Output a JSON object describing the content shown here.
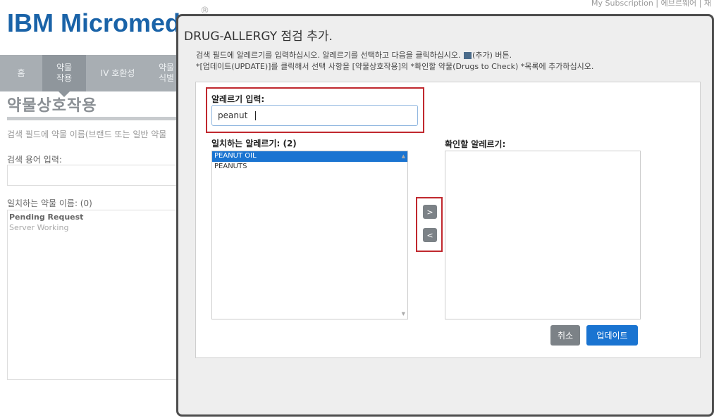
{
  "app": {
    "logo": "IBM Micromede",
    "reg_mark": "®",
    "top_links": "My Subscription | 에브르웨어 | 재"
  },
  "nav": {
    "items": [
      {
        "label": "홈",
        "sub": ""
      },
      {
        "label": "약물",
        "sub": "작용"
      },
      {
        "label": "IV 호환성",
        "sub": ""
      },
      {
        "label": "약물",
        "sub": "식별"
      }
    ]
  },
  "page": {
    "title": "약물상호작용",
    "search_hint": "검색 필드에 약물 이름(브랜드 또는 일반 약물",
    "search_label": "검색 용어 입력:",
    "matches_label": "일치하는 약물 이름: (0)",
    "pending": "Pending Request",
    "working": "Server Working"
  },
  "modal": {
    "title": "DRUG-ALLERGY 점검 추가.",
    "instruction_1a": "검색 필드에 알레르기를 입력하십시오. 알레르기를 선택하고 다음을 클릭하십시오.",
    "instruction_1b": "(추가) 버튼.",
    "instruction_2": "*[업데이트(UPDATE)]를 클릭해서 선택 사항을 [약물상호작용]의 *확인할 약물(Drugs to Check) *목록에 추가하십시오.",
    "allergy_input_label": "알레르기 입력:",
    "allergy_input_value": "peanut",
    "matching_label": "일치하는 알레르기: (2)",
    "matching_items": [
      "PEANUT OIL",
      "PEANUTS"
    ],
    "selected_index": 0,
    "check_label": "확인할 알레르기:",
    "add_label": ">",
    "remove_label": "<",
    "cancel_label": "취소",
    "update_label": "업데이트",
    "scroll_up": "▲",
    "scroll_down": "▼"
  },
  "colors": {
    "brand": "#1a63a8",
    "nav_bg": "#a8aeb3",
    "nav_active": "#8f969c",
    "highlight": "#c0282e",
    "primary": "#1a74d1",
    "secondary": "#7c8287",
    "modal_border": "#4d4d4d"
  },
  "icons": {
    "inline_add": "add-icon"
  }
}
